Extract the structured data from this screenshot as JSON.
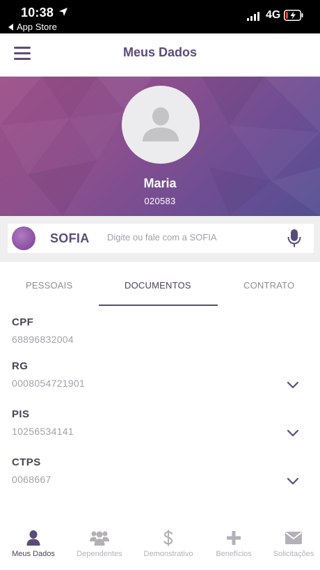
{
  "status_bar": {
    "time": "10:38",
    "back_app": "App Store",
    "network": "4G",
    "battery_level": 0.15,
    "battery_color": "#ff3b30"
  },
  "header": {
    "title": "Meus Dados",
    "menu_icon": "hamburger-menu-icon"
  },
  "profile": {
    "name": "Maria",
    "id": "020583",
    "avatar_icon": "user-silhouette-icon"
  },
  "assistant": {
    "name": "SOFIA",
    "placeholder": "Digite ou fale com a SOFIA",
    "mic_icon": "microphone-icon"
  },
  "tabs": [
    {
      "label": "PESSOAIS",
      "active": false
    },
    {
      "label": "DOCUMENTOS",
      "active": true
    },
    {
      "label": "CONTRATO",
      "active": false
    }
  ],
  "documents": [
    {
      "label": "CPF",
      "value": "68896832004",
      "expandable": false
    },
    {
      "label": "RG",
      "value": "0008054721901",
      "expandable": true
    },
    {
      "label": "PIS",
      "value": "10256534141",
      "expandable": true
    },
    {
      "label": "CTPS",
      "value": "0068667",
      "expandable": true
    }
  ],
  "bottom_nav": [
    {
      "label": "Meus Dados",
      "icon": "user-icon",
      "active": true
    },
    {
      "label": "Dependentes",
      "icon": "group-icon",
      "active": false
    },
    {
      "label": "Demonstrativo",
      "icon": "dollar-icon",
      "active": false
    },
    {
      "label": "Benefícios",
      "icon": "plus-icon",
      "active": false
    },
    {
      "label": "Solicitações",
      "icon": "envelope-icon",
      "active": false
    }
  ],
  "colors": {
    "brand": "#5b4b78",
    "hero_start": "#9b4f86",
    "hero_end": "#534f92",
    "inactive": "#b3b1b7"
  }
}
